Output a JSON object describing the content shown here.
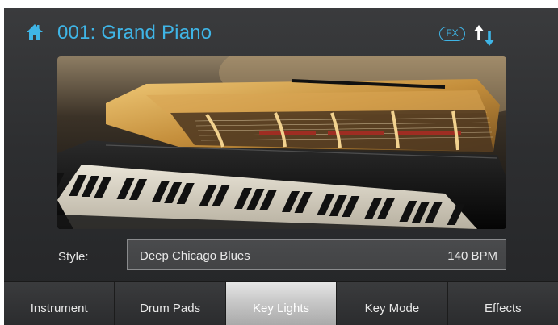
{
  "header": {
    "title": "001: Grand Piano",
    "fx_label": "FX",
    "home_icon": "home-icon",
    "sort_icon": "up-down-arrows-icon",
    "accent_color": "#3fb5e6"
  },
  "preview": {
    "image": "grand-piano-photo"
  },
  "style_row": {
    "label": "Style:",
    "value": "Deep Chicago Blues",
    "tempo": "140 BPM"
  },
  "tabs": [
    {
      "label": "Instrument",
      "active": false
    },
    {
      "label": "Drum Pads",
      "active": false
    },
    {
      "label": "Key Lights",
      "active": true
    },
    {
      "label": "Key Mode",
      "active": false
    },
    {
      "label": "Effects",
      "active": false
    }
  ]
}
